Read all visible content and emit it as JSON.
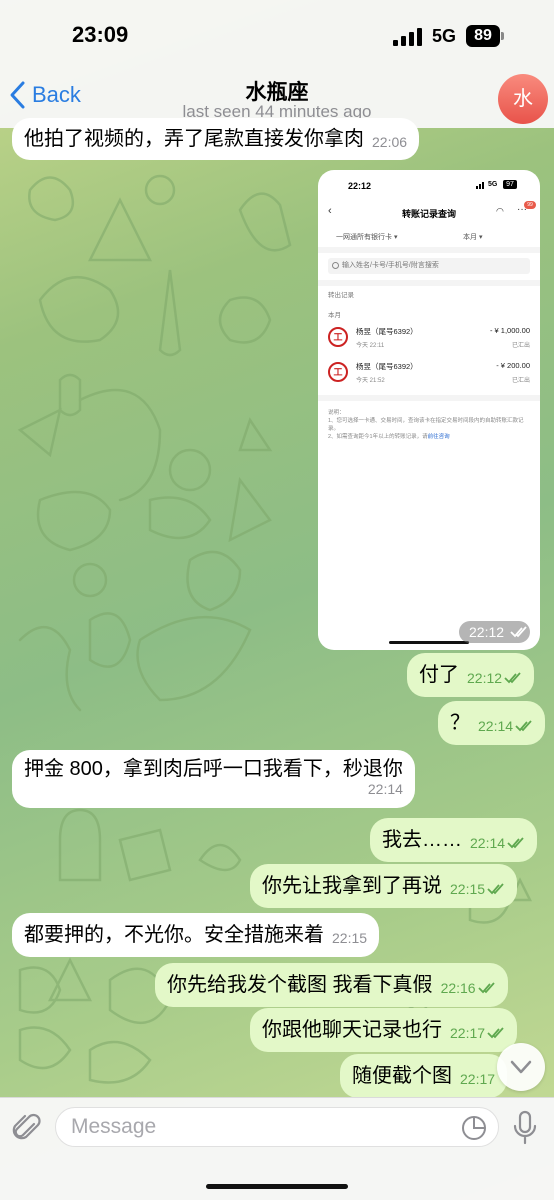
{
  "status_bar": {
    "time": "23:09",
    "network": "5G",
    "battery": "89"
  },
  "header": {
    "back_label": "Back",
    "title": "水瓶座",
    "subtitle": "last seen 44 minutes ago",
    "avatar_initial": "水"
  },
  "messages": [
    {
      "text": "他拍了视频的，弄了尾款直接发你拿肉",
      "time": "22:06"
    },
    {
      "image": {
        "time": "22:12",
        "screenshot": {
          "status_time": "22:12",
          "network": "5G",
          "battery": "97",
          "title": "转账记录查询",
          "badge": "99",
          "filter_bank": "一网通所有银行卡",
          "filter_period": "本月",
          "search_placeholder": "输入姓名/卡号/手机号/附言搜索",
          "section": "转出记录",
          "month": "本月",
          "records": [
            {
              "name": "杨昱（尾号6392）",
              "date": "今天 22:11",
              "amount": "- ¥ 1,000.00",
              "status": "已汇出"
            },
            {
              "name": "杨昱（尾号6392）",
              "date": "今天 21:52",
              "amount": "- ¥ 200.00",
              "status": "已汇出"
            }
          ],
          "note_title": "说明：",
          "note_1": "1、您可选择一卡通、交易时间，查询该卡在指定交易时间段内的自助转账汇款记录。",
          "note_2": "2、如需查询距今1年以上的转账记录，请",
          "note_link": "前往咨询"
        }
      }
    },
    {
      "text": "付了",
      "time": "22:12"
    },
    {
      "text": "？",
      "time": "22:14"
    },
    {
      "text": "押金 800，拿到肉后呼一口我看下，秒退你",
      "time": "22:14"
    },
    {
      "text": "我去……",
      "time": "22:14"
    },
    {
      "text": "你先让我拿到了再说",
      "time": "22:15"
    },
    {
      "text": "都要押的，不光你。安全措施来着",
      "time": "22:15"
    },
    {
      "text": "你先给我发个截图 我看下真假",
      "time": "22:16"
    },
    {
      "text": "你跟他聊天记录也行",
      "time": "22:17"
    },
    {
      "text": "随便截个图",
      "time": "22:17"
    }
  ],
  "composer": {
    "placeholder": "Message"
  },
  "colors": {
    "accent": "#2a7de1",
    "outgoing_bubble": "#e3f8c8",
    "incoming_bubble": "#ffffff",
    "read_ticks": "#5fa84f"
  },
  "icons": [
    "back-chevron-icon",
    "paperclip-icon",
    "sticker-icon",
    "microphone-icon",
    "chevron-down-icon",
    "double-check-icon"
  ]
}
